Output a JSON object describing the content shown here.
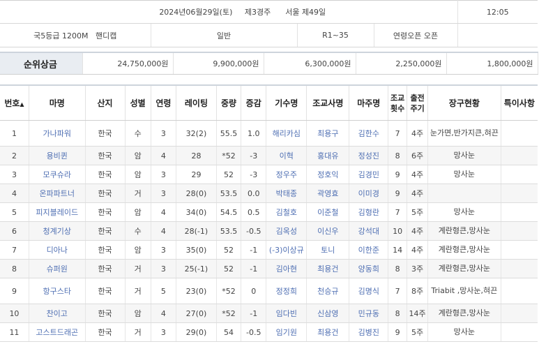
{
  "race_info": {
    "date": "2024년06월29일(토)",
    "week": "제3경주",
    "place": "서울 제49일",
    "time": "12:05",
    "grade": "국5등급",
    "distance": "1200M",
    "handicap": "핸디캡",
    "category": "일반",
    "rating_range": "R1~35",
    "age_cond": "연령오픈",
    "sex_cond": "오픈"
  },
  "prize": {
    "label": "순위상금",
    "values": [
      "24,750,000원",
      "9,900,000원",
      "6,300,000원",
      "2,250,000원",
      "1,800,000원"
    ]
  },
  "headers": {
    "no": "번호",
    "horse": "마명",
    "origin": "산지",
    "sex": "성별",
    "age": "연령",
    "rating": "레이팅",
    "weight": "중량",
    "weight_change": "증감",
    "jockey": "기수명",
    "trainer": "조교사명",
    "owner": "마주명",
    "training_count_1": "조교",
    "training_count_2": "횟수",
    "interval_1": "출전",
    "interval_2": "주기",
    "equipment": "장구현황",
    "notes": "특이사항"
  },
  "rows": [
    {
      "no": "1",
      "horse": "가나파워",
      "origin": "한국",
      "sex": "수",
      "age": "3",
      "rating": "32(2)",
      "weight": "55.5",
      "change": "1.0",
      "jockey": "해리카심",
      "trainer": "최용구",
      "owner": "김한수",
      "count": "7",
      "interval": "4주",
      "equipment": "눈가면,반가지큰,혀끈",
      "notes": ""
    },
    {
      "no": "2",
      "horse": "용비퀸",
      "origin": "한국",
      "sex": "암",
      "age": "4",
      "rating": "28",
      "weight": "*52",
      "change": "-3",
      "jockey": "이혁",
      "trainer": "홍대유",
      "owner": "정성진",
      "count": "8",
      "interval": "6주",
      "equipment": "망사눈",
      "notes": ""
    },
    {
      "no": "3",
      "horse": "모쿠슈라",
      "origin": "한국",
      "sex": "암",
      "age": "3",
      "rating": "29",
      "weight": "52",
      "change": "-3",
      "jockey": "정우주",
      "trainer": "정호익",
      "owner": "김경민",
      "count": "9",
      "interval": "4주",
      "equipment": "망사눈",
      "notes": ""
    },
    {
      "no": "4",
      "horse": "온파파트너",
      "origin": "한국",
      "sex": "거",
      "age": "3",
      "rating": "28(0)",
      "weight": "53.5",
      "change": "0.0",
      "jockey": "박태종",
      "trainer": "곽영효",
      "owner": "이미경",
      "count": "9",
      "interval": "4주",
      "equipment": "",
      "notes": ""
    },
    {
      "no": "5",
      "horse": "피지블레이드",
      "origin": "한국",
      "sex": "암",
      "age": "4",
      "rating": "34(0)",
      "weight": "54.5",
      "change": "0.5",
      "jockey": "김철호",
      "trainer": "이준철",
      "owner": "김형란",
      "count": "7",
      "interval": "5주",
      "equipment": "망사눈",
      "notes": ""
    },
    {
      "no": "6",
      "horse": "청계기상",
      "origin": "한국",
      "sex": "수",
      "age": "4",
      "rating": "28(-1)",
      "weight": "53.5",
      "change": "-0.5",
      "jockey": "김옥성",
      "trainer": "이신우",
      "owner": "강석대",
      "count": "10",
      "interval": "4주",
      "equipment": "계란형큰,망사눈",
      "notes": ""
    },
    {
      "no": "7",
      "horse": "디아나",
      "origin": "한국",
      "sex": "암",
      "age": "3",
      "rating": "35(0)",
      "weight": "52",
      "change": "-1",
      "jockey": "(-3)이상규",
      "trainer": "토니",
      "owner": "이한준",
      "count": "14",
      "interval": "4주",
      "equipment": "계란형큰,망사눈",
      "notes": ""
    },
    {
      "no": "8",
      "horse": "슈퍼원",
      "origin": "한국",
      "sex": "거",
      "age": "3",
      "rating": "25(-1)",
      "weight": "52",
      "change": "-1",
      "jockey": "김아현",
      "trainer": "최용건",
      "owner": "양동희",
      "count": "8",
      "interval": "3주",
      "equipment": "계란형큰,망사눈",
      "notes": ""
    },
    {
      "no": "9",
      "horse": "항구스타",
      "origin": "한국",
      "sex": "거",
      "age": "5",
      "rating": "23(0)",
      "weight": "*52",
      "change": "0",
      "jockey": "정정희",
      "trainer": "천승규",
      "owner": "김명식",
      "count": "7",
      "interval": "8주",
      "equipment": "Triabit ,망사눈,혀끈",
      "notes": ""
    },
    {
      "no": "10",
      "horse": "찬이고",
      "origin": "한국",
      "sex": "암",
      "age": "4",
      "rating": "27(0)",
      "weight": "*52",
      "change": "-1",
      "jockey": "임다빈",
      "trainer": "신삼영",
      "owner": "민규동",
      "count": "8",
      "interval": "14주",
      "equipment": "계란형큰,망사눈",
      "notes": ""
    },
    {
      "no": "11",
      "horse": "고스트드래곤",
      "origin": "한국",
      "sex": "거",
      "age": "3",
      "rating": "29(0)",
      "weight": "54",
      "change": "-0.5",
      "jockey": "임기원",
      "trainer": "최용건",
      "owner": "김병진",
      "count": "9",
      "interval": "5주",
      "equipment": "망사눈",
      "notes": ""
    }
  ]
}
